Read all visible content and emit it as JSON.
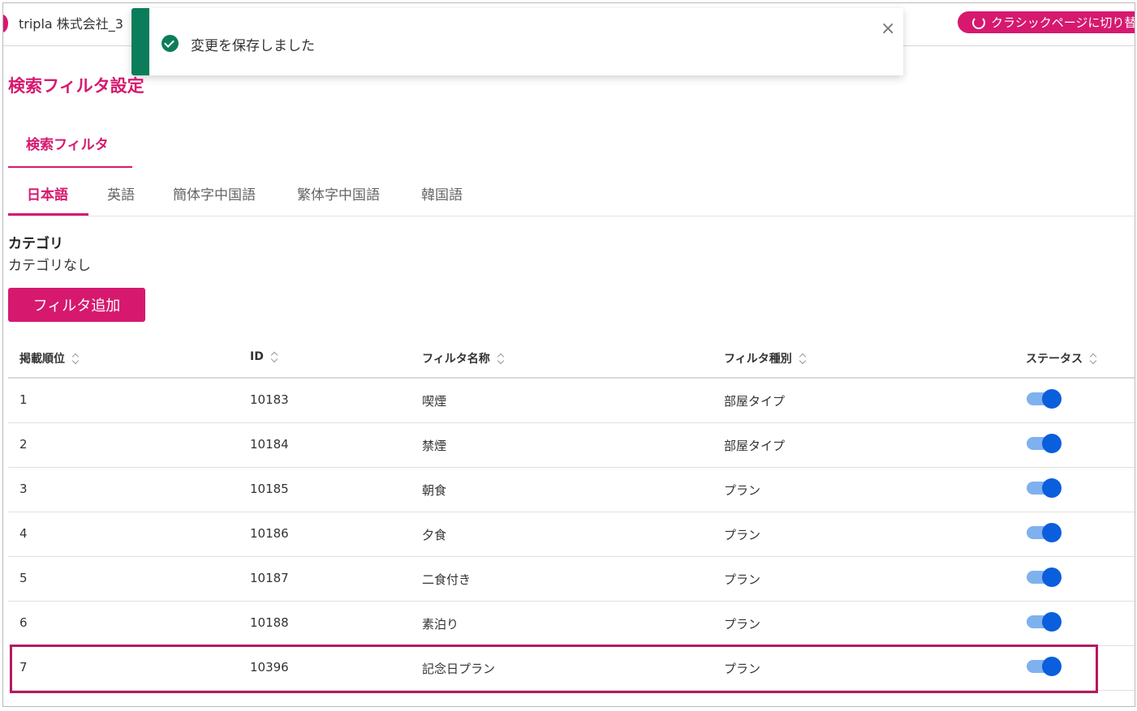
{
  "header": {
    "account_name": "tripla 株式会社_3",
    "classic_button_label": "クラシックページに切り替え"
  },
  "toast": {
    "message": "変更を保存しました",
    "close_symbol": "×"
  },
  "page": {
    "title": "検索フィルタ設定",
    "main_tab": "検索フィルタ"
  },
  "language_tabs": [
    "日本語",
    "英語",
    "簡体字中国語",
    "繁体字中国語",
    "韓国語"
  ],
  "category": {
    "label": "カテゴリ",
    "value": "カテゴリなし"
  },
  "add_filter_button": "フィルタ追加",
  "table": {
    "headers": [
      "掲載順位",
      "ID",
      "フィルタ名称",
      "フィルタ種別",
      "ステータス"
    ],
    "rows": [
      {
        "order": "1",
        "id": "10183",
        "name": "喫煙",
        "type": "部屋タイプ",
        "status_on": true
      },
      {
        "order": "2",
        "id": "10184",
        "name": "禁煙",
        "type": "部屋タイプ",
        "status_on": true
      },
      {
        "order": "3",
        "id": "10185",
        "name": "朝食",
        "type": "プラン",
        "status_on": true
      },
      {
        "order": "4",
        "id": "10186",
        "name": "夕食",
        "type": "プラン",
        "status_on": true
      },
      {
        "order": "5",
        "id": "10187",
        "name": "二食付き",
        "type": "プラン",
        "status_on": true
      },
      {
        "order": "6",
        "id": "10188",
        "name": "素泊り",
        "type": "プラン",
        "status_on": true
      },
      {
        "order": "7",
        "id": "10396",
        "name": "記念日プラン",
        "type": "プラン",
        "status_on": true
      }
    ]
  },
  "colors": {
    "brand": "#d6196f",
    "success": "#0b7d5a",
    "toggle_on": "#0b5fdc",
    "highlight": "#b51960"
  }
}
